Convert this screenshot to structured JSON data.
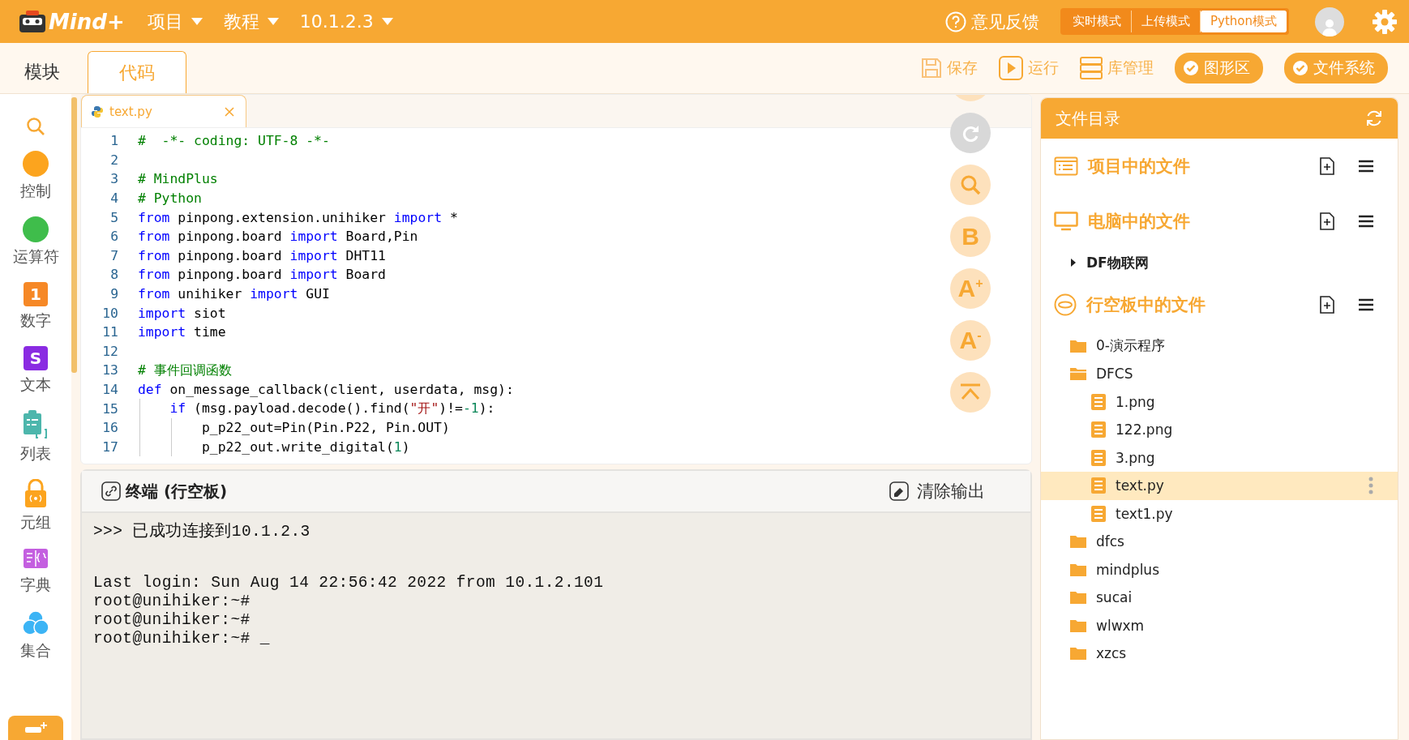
{
  "top_bar": {
    "logo_text": "Mind+",
    "menus": [
      {
        "label": "项目"
      },
      {
        "label": "教程"
      },
      {
        "label": "10.1.2.3"
      }
    ],
    "feedback": "意见反馈",
    "modes": [
      {
        "label": "实时模式",
        "selected": false
      },
      {
        "label": "上传模式",
        "selected": false
      },
      {
        "label": "Python模式",
        "selected": true
      }
    ]
  },
  "view_tabs": [
    {
      "label": "模块",
      "selected": false
    },
    {
      "label": "代码",
      "selected": true
    }
  ],
  "toolbar": [
    {
      "label": "保存",
      "kind": "save",
      "on": false
    },
    {
      "label": "运行",
      "kind": "run",
      "on": false
    },
    {
      "label": "库管理",
      "kind": "library",
      "on": false
    },
    {
      "label": "图形区",
      "kind": "toggle",
      "on": true
    },
    {
      "label": "文件系统",
      "kind": "toggle",
      "on": true
    }
  ],
  "categories": [
    {
      "kind": "search"
    },
    {
      "label": "控制",
      "kind": "circle",
      "color": "#fca41e"
    },
    {
      "label": "运算符",
      "kind": "circle",
      "color": "#3fbd4b"
    },
    {
      "label": "数字",
      "kind": "number",
      "color": "#f68826",
      "icon_text": "1"
    },
    {
      "label": "文本",
      "kind": "text",
      "color": "#8a2be2",
      "icon_text": "S"
    },
    {
      "label": "列表",
      "kind": "list",
      "color": "#4db6ac"
    },
    {
      "label": "元组",
      "kind": "lock",
      "color": "#fca41e"
    },
    {
      "label": "字典",
      "kind": "dict",
      "color": "#c45fe0"
    },
    {
      "label": "集合",
      "kind": "set",
      "color": "#3cb4f5"
    }
  ],
  "editor": {
    "tab": {
      "label": "text.py",
      "selected": true
    },
    "lines": [
      {
        "number": "1",
        "tokens": [
          {
            "kind": "comment",
            "text": "#  -*- coding: UTF-8 -*-"
          }
        ]
      },
      {
        "number": "2"
      },
      {
        "number": "3",
        "tokens": [
          {
            "kind": "comment",
            "text": "# MindPlus"
          }
        ]
      },
      {
        "number": "4",
        "tokens": [
          {
            "kind": "comment",
            "text": "# Python"
          }
        ]
      },
      {
        "number": "5",
        "tokens": [
          {
            "kind": "keyword",
            "text": "from"
          },
          {
            "kind": "plain",
            "text": " pinpong.extension.unihiker "
          },
          {
            "kind": "keyword",
            "text": "import"
          },
          {
            "kind": "plain",
            "text": " *"
          }
        ]
      },
      {
        "number": "6",
        "tokens": [
          {
            "kind": "keyword",
            "text": "from"
          },
          {
            "kind": "plain",
            "text": " pinpong.board "
          },
          {
            "kind": "keyword",
            "text": "import"
          },
          {
            "kind": "plain",
            "text": " Board,Pin"
          }
        ]
      },
      {
        "number": "7",
        "tokens": [
          {
            "kind": "keyword",
            "text": "from"
          },
          {
            "kind": "plain",
            "text": " pinpong.board "
          },
          {
            "kind": "keyword",
            "text": "import"
          },
          {
            "kind": "plain",
            "text": " DHT11"
          }
        ]
      },
      {
        "number": "8",
        "tokens": [
          {
            "kind": "keyword",
            "text": "from"
          },
          {
            "kind": "plain",
            "text": " pinpong.board "
          },
          {
            "kind": "keyword",
            "text": "import"
          },
          {
            "kind": "plain",
            "text": " Board"
          }
        ]
      },
      {
        "number": "9",
        "tokens": [
          {
            "kind": "keyword",
            "text": "from"
          },
          {
            "kind": "plain",
            "text": " unihiker "
          },
          {
            "kind": "keyword",
            "text": "import"
          },
          {
            "kind": "plain",
            "text": " GUI"
          }
        ]
      },
      {
        "number": "10",
        "tokens": [
          {
            "kind": "keyword",
            "text": "import"
          },
          {
            "kind": "plain",
            "text": " siot"
          }
        ]
      },
      {
        "number": "11",
        "tokens": [
          {
            "kind": "keyword",
            "text": "import"
          },
          {
            "kind": "plain",
            "text": " time"
          }
        ]
      },
      {
        "number": "12"
      },
      {
        "number": "13",
        "tokens": [
          {
            "kind": "comment",
            "text": "# 事件回调函数"
          }
        ]
      },
      {
        "number": "14",
        "tokens": [
          {
            "kind": "keyword",
            "text": "def"
          },
          {
            "kind": "plain",
            "text": " on_message_callback(client, userdata, msg):"
          }
        ],
        "children": [
          {
            "number": "15",
            "tokens": [
              {
                "kind": "keyword",
                "text": "if"
              },
              {
                "kind": "plain",
                "text": " (msg.payload.decode().find("
              },
              {
                "kind": "string",
                "text": "\"开\""
              },
              {
                "kind": "plain",
                "text": ")!="
              },
              {
                "kind": "number",
                "text": "-1"
              },
              {
                "kind": "plain",
                "text": "):"
              }
            ],
            "children": [
              {
                "number": "16",
                "tokens": [
                  {
                    "kind": "plain",
                    "text": "p_p22_out=Pin(Pin.P22, Pin.OUT)"
                  }
                ]
              },
              {
                "number": "17",
                "tokens": [
                  {
                    "kind": "plain",
                    "text": "p_p22_out.write_digital("
                  },
                  {
                    "kind": "number",
                    "text": "1"
                  },
                  {
                    "kind": "plain",
                    "text": ")"
                  }
                ]
              }
            ]
          }
        ]
      }
    ],
    "side_buttons": [
      {
        "kind": "redo",
        "disabled": true
      },
      {
        "kind": "search",
        "disabled": false
      },
      {
        "kind": "bold",
        "disabled": false,
        "glyph": "B"
      },
      {
        "kind": "bigger",
        "disabled": false,
        "glyph": "A",
        "sign": "+"
      },
      {
        "kind": "smaller",
        "disabled": false,
        "glyph": "A",
        "sign": "-"
      },
      {
        "kind": "top",
        "disabled": false
      }
    ]
  },
  "terminal": {
    "title": "终端 (行空板)",
    "clear_button": "清除输出",
    "groups": [
      {
        "lines": [
          ">>> 已成功连接到10.1.2.3"
        ]
      },
      {
        "lines": [
          "Last login: Sun Aug 14 22:56:42 2022 from 10.1.2.101",
          "root@unihiker:~#",
          "root@unihiker:~#",
          "root@unihiker:~# _"
        ]
      }
    ]
  },
  "file_panel": {
    "title": "文件目录",
    "sections": [
      {
        "label": "项目中的文件",
        "kind": "project"
      },
      {
        "label": "电脑中的文件",
        "kind": "computer",
        "children": [
          {
            "label": "DF物联网",
            "kind": "group",
            "expanded": false
          }
        ]
      },
      {
        "label": "行空板中的文件",
        "kind": "board",
        "children": [
          {
            "label": "0-演示程序",
            "kind": "folder",
            "expanded": false,
            "selected": false
          },
          {
            "label": "DFCS",
            "kind": "folder",
            "expanded": true,
            "selected": false,
            "children": [
              {
                "label": "1.png",
                "kind": "file",
                "selected": false
              },
              {
                "label": "122.png",
                "kind": "file",
                "selected": false
              },
              {
                "label": "3.png",
                "kind": "file",
                "selected": false
              },
              {
                "label": "text.py",
                "kind": "file",
                "selected": true
              },
              {
                "label": "text1.py",
                "kind": "file",
                "selected": false
              }
            ]
          },
          {
            "label": "dfcs",
            "kind": "folder",
            "expanded": false,
            "selected": false
          },
          {
            "label": "mindplus",
            "kind": "folder",
            "expanded": false,
            "selected": false
          },
          {
            "label": "sucai",
            "kind": "folder",
            "expanded": false,
            "selected": false
          },
          {
            "label": "wlwxm",
            "kind": "folder",
            "expanded": false,
            "selected": false
          },
          {
            "label": "xzcs",
            "kind": "folder",
            "expanded": false,
            "selected": false
          }
        ]
      }
    ]
  }
}
